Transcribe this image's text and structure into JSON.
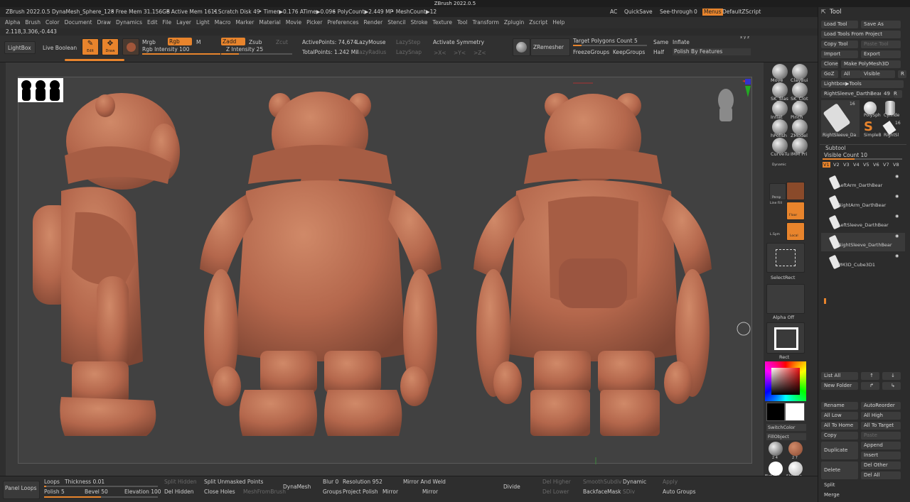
{
  "title": "ZBrush 2022.0.5",
  "status": {
    "app": "ZBrush 2022.0.5 DynaMesh_Sphere_128",
    "free_mem": "• Free Mem 31.156GB",
    "active_mem": "• Active Mem 1611",
    "scratch": "• Scratch Disk 49",
    "timer": "• Timer▶0.176 ATime▶0.096",
    "polycount": "• PolyCount▶2.449 MP",
    "meshcount": "• MeshCount▶12",
    "ac": "AC",
    "quicksave": "QuickSave",
    "seethrough": "See-through",
    "seethrough_val": "0",
    "menus": "Menus",
    "defaultzscript": "DefaultZScript"
  },
  "menu": [
    "Alpha",
    "Brush",
    "Color",
    "Document",
    "Draw",
    "Dynamics",
    "Edit",
    "File",
    "Layer",
    "Light",
    "Macro",
    "Marker",
    "Material",
    "Movie",
    "Picker",
    "Preferences",
    "Render",
    "Stencil",
    "Stroke",
    "Texture",
    "Tool",
    "Transform",
    "Zplugin",
    "Zscript",
    "Help"
  ],
  "coords": "2.118,3.306,-0.443",
  "shelf": {
    "lightbox": "LightBox",
    "live_boolean": "Live Boolean",
    "edit": "Edit",
    "draw": "Draw",
    "mrgb": "Mrgb",
    "rgb": "Rgb",
    "m": "M",
    "rgb_intensity": "Rgb Intensity 100",
    "zadd": "Zadd",
    "zsub": "Zsub",
    "zcut": "Zcut",
    "z_intensity": "Z Intensity 25",
    "active_points": "ActivePoints: 74,674",
    "total_points": "TotalPoints: 1.242 Mil",
    "lazymouse": "LazyMouse",
    "lazystep": "LazyStep",
    "lazyradius": "LazyRadius",
    "lazysnap": "LazySnap",
    "activate_symmetry": "Activate Symmetry",
    "sym_x": ">X<",
    "sym_y": ">Y<",
    "sym_z": ">Z<",
    "zremesher": "ZRemesher",
    "target_polygons": "Target Polygons Count 5",
    "freeze_groups": "FreezeGroups",
    "keep_groups": "KeepGroups",
    "same": "Same",
    "half": "Half",
    "inflate": "Inflate",
    "polish_by_features": "Polish By Features",
    "xyz": "x y z"
  },
  "brushes": [
    {
      "label": "Move"
    },
    {
      "label": "ClayBui"
    },
    {
      "label": "SK_Slas"
    },
    {
      "label": "SK_Clot"
    },
    {
      "label": "Inflat"
    },
    {
      "label": "Pinch"
    },
    {
      "label": "hPolish"
    },
    {
      "label": "ZModel"
    },
    {
      "label": "CurveTu"
    },
    {
      "label": "IMM Pri"
    }
  ],
  "rightshelf": {
    "dynamic": "Dynamic",
    "persp": "Persp",
    "floor": "Floor",
    "local": "Local",
    "line_fill": "Line Fill",
    "sym": "L.Sym",
    "select_rect": "SelectRect",
    "alpha_off": "Alpha Off",
    "rect": "Rect",
    "switch_color": "SwitchColor",
    "fill_object": "FillObject",
    "flat_color": "Flat Col",
    "skinshade": "SkinSha",
    "mat_num1": "2 4",
    "mat_num2": "2 7"
  },
  "tool": {
    "header": "Tool",
    "load_tool": "Load Tool",
    "save_as": "Save As",
    "load_from_project": "Load Tools From Project",
    "copy_tool": "Copy Tool",
    "paste_tool": "Paste Tool",
    "import": "Import",
    "export": "Export",
    "clone": "Clone",
    "make_polymesh": "Make PolyMesh3D",
    "goz": "GoZ",
    "all": "All",
    "visible": "Visible",
    "r": "R",
    "lightbox_tools": "Lightbox▶Tools",
    "current_tool": "RightSleeve_DarthBear",
    "current_tool_num": "49",
    "thumb_names": [
      "RightSleeve_Da",
      "PolySph",
      "Cylinde",
      "SimpleB",
      "RightSl"
    ],
    "thumb_count1": "16",
    "thumb_count2": "16",
    "subtool": "Subtool",
    "visible_count": "Visible Count 10",
    "versions": [
      "V1",
      "V2",
      "V3",
      "V4",
      "V5",
      "V6",
      "V7",
      "V8"
    ],
    "subtools": [
      "LeftArm_DarthBear",
      "RightArm_DarthBear",
      "LeftSleeve_DarthBear",
      "RightSleeve_DarthBear",
      "PM3D_Cube3D1"
    ],
    "list_all": "List All",
    "new_folder": "New Folder",
    "rename": "Rename",
    "autoreorder": "AutoReorder",
    "all_low": "All Low",
    "all_high": "All High",
    "all_to_home": "All To Home",
    "all_to_target": "All To Target",
    "copy": "Copy",
    "paste": "Paste",
    "duplicate": "Duplicate",
    "append": "Append",
    "insert": "Insert",
    "delete": "Delete",
    "del_other": "Del Other",
    "del_all": "Del All",
    "split": "Split",
    "merge": "Merge"
  },
  "bottom": {
    "panel_loops": "Panel Loops",
    "loops": "Loops",
    "thickness": "Thickness 0.01",
    "polish": "Polish 5",
    "bevel": "Bevel 50",
    "elevation": "Elevation 100",
    "split_hidden": "Split Hidden",
    "del_hidden": "Del Hidden",
    "split_unmasked": "Split Unmasked Points",
    "close_holes": "Close Holes",
    "mesh_from_brush": "MeshFromBrush",
    "dynamesh": "DynaMesh",
    "blur": "Blur 0",
    "resolution": "Resolution 952",
    "groups": "Groups",
    "project": "Project",
    "polish_btn": "Polish",
    "mirror_weld": "Mirror And Weld",
    "mirror1": "Mirror",
    "mirror2": "Mirror",
    "divide": "Divide",
    "del_higher": "Del Higher",
    "del_lower": "Del Lower",
    "smooth_subdiv": "SmoothSubdiv",
    "backface_mask": "BackfaceMask",
    "dynamic": "Dynamic",
    "sdiv": "SDiv",
    "apply": "Apply",
    "auto_groups": "Auto Groups"
  },
  "colors": {
    "accent": "#e8842c",
    "clay": "#b4674c",
    "panel": "#2c2c2c"
  }
}
